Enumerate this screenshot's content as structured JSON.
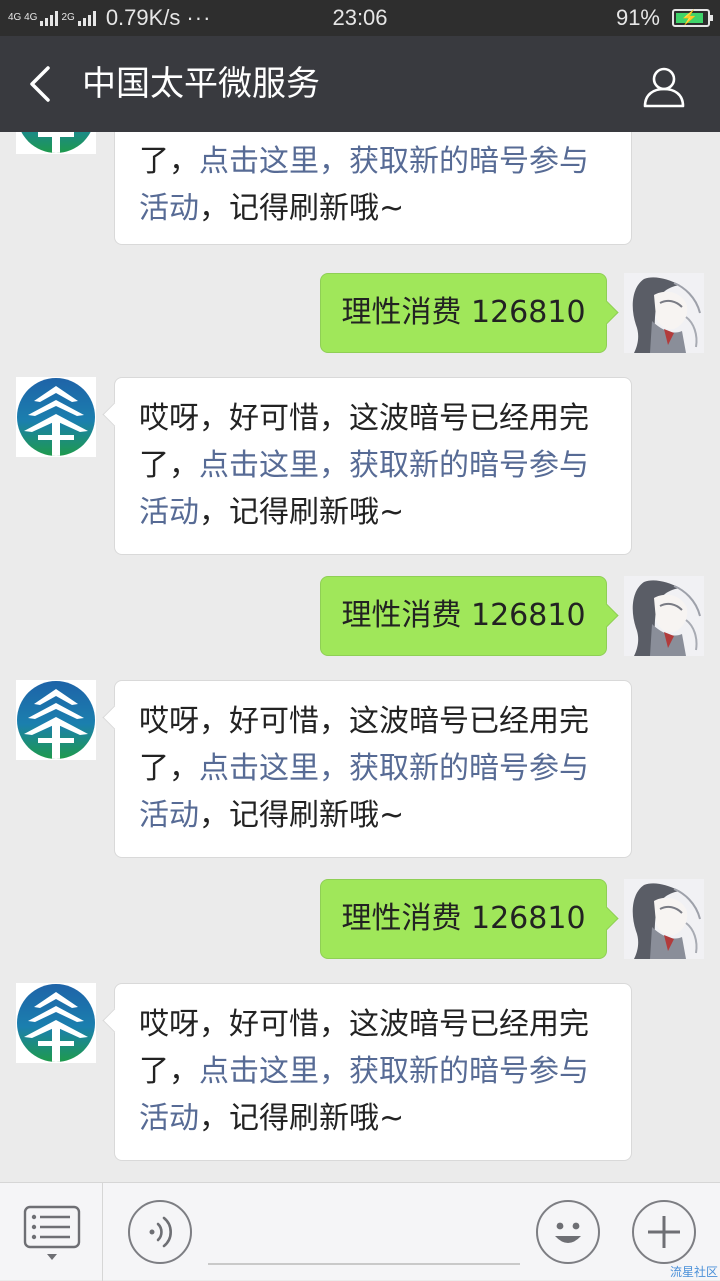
{
  "status_bar": {
    "network_top": "4G 4G",
    "network_2g": "2G",
    "speed": "0.79K/s",
    "dots": "···",
    "time": "23:06",
    "battery_percent": "91%",
    "battery_level": 0.91,
    "battery_color": "#3fd36a",
    "charging_symbol": "⚡"
  },
  "header": {
    "back_icon": "chevron-left-icon",
    "title": "中国太平微服务",
    "profile_icon": "person-icon"
  },
  "bot_reply": {
    "part1": "哎呀，好可惜，这波暗号已经用完了，",
    "link": "点击这里，获取新的暗号参与活动",
    "part2": "，记得刷新哦~"
  },
  "partial_reply": {
    "part1": "了，",
    "link_line1": "点击这里，获取新的暗号参与",
    "link_line2": "活动",
    "part2": "，记得刷新哦~"
  },
  "messages": [
    {
      "sender": "user",
      "text": "理性消费 126810"
    },
    {
      "sender": "bot"
    },
    {
      "sender": "user",
      "text": "理性消费 126810"
    },
    {
      "sender": "bot"
    },
    {
      "sender": "user",
      "text": "理性消费 126810"
    },
    {
      "sender": "bot"
    }
  ],
  "colors": {
    "header_bg": "#393a3f",
    "status_bg": "#2e2e2e",
    "chat_bg": "#ebebeb",
    "outgoing_bubble": "#a0e75a",
    "link": "#576b95",
    "logo_blue": "#1e63a8",
    "logo_green": "#1e9a4c"
  },
  "bottom_bar": {
    "menu_icon": "list-menu-icon",
    "voice_icon": "voice-icon",
    "emoji_icon": "smiley-icon",
    "add_icon": "plus-icon",
    "watermark": "流星社区"
  }
}
